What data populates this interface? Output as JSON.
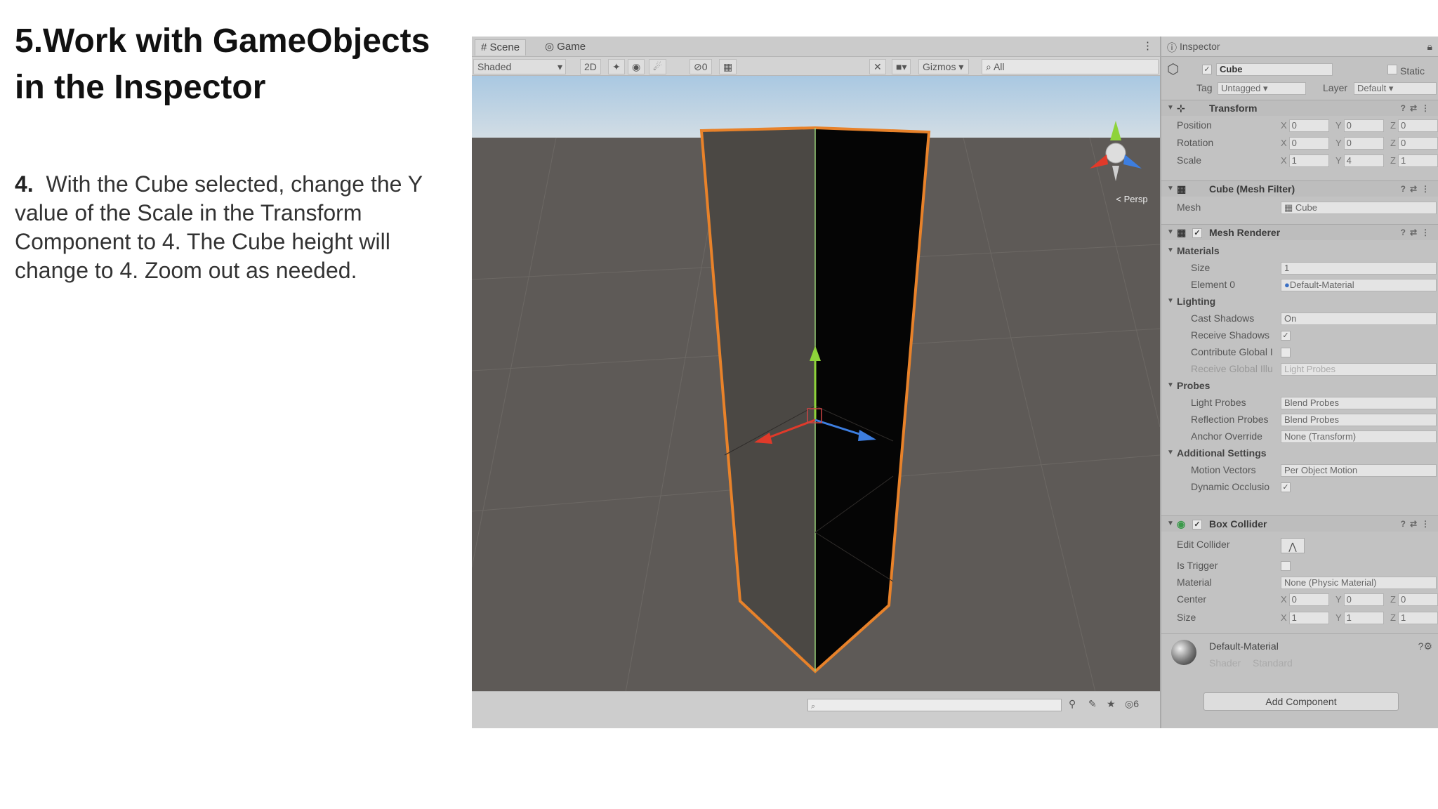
{
  "slide": {
    "title_line1": "5.Work with GameObjects",
    "title_line2": "in the Inspector",
    "step_number": "4.",
    "step_text": "With the Cube selected, change the Y value of the Scale in the Transform Component to 4. The Cube height will change to 4. Zoom out as needed."
  },
  "scene": {
    "tab_scene": "Scene",
    "tab_game": "Game",
    "shading_mode": "Shaded",
    "mode_2d": "2D",
    "gizmos_label": "Gizmos",
    "search_placeholder": "All",
    "persp_label": "< Persp",
    "layers_count": "0",
    "bottom_count": "6"
  },
  "inspector": {
    "tab_label": "Inspector",
    "object_name": "Cube",
    "static_label": "Static",
    "tag_label": "Tag",
    "tag_value": "Untagged",
    "layer_label": "Layer",
    "layer_value": "Default",
    "transform": {
      "title": "Transform",
      "position_label": "Position",
      "position": {
        "x": "0",
        "y": "0",
        "z": "0"
      },
      "rotation_label": "Rotation",
      "rotation": {
        "x": "0",
        "y": "0",
        "z": "0"
      },
      "scale_label": "Scale",
      "scale": {
        "x": "1",
        "y": "4",
        "z": "1"
      }
    },
    "mesh_filter": {
      "title": "Cube (Mesh Filter)",
      "mesh_label": "Mesh",
      "mesh_value": "Cube"
    },
    "mesh_renderer": {
      "title": "Mesh Renderer",
      "materials_label": "Materials",
      "size_label": "Size",
      "size_value": "1",
      "element0_label": "Element 0",
      "element0_value": "Default-Material",
      "lighting_label": "Lighting",
      "cast_shadows_label": "Cast Shadows",
      "cast_shadows_value": "On",
      "receive_shadows_label": "Receive Shadows",
      "contribute_gi_label": "Contribute Global I",
      "receive_gi_label": "Receive Global Illu",
      "receive_gi_value": "Light Probes",
      "probes_label": "Probes",
      "light_probes_label": "Light Probes",
      "light_probes_value": "Blend Probes",
      "reflection_probes_label": "Reflection Probes",
      "reflection_probes_value": "Blend Probes",
      "anchor_override_label": "Anchor Override",
      "anchor_override_value": "None (Transform)",
      "additional_label": "Additional Settings",
      "motion_vectors_label": "Motion Vectors",
      "motion_vectors_value": "Per Object Motion",
      "dynamic_occlusion_label": "Dynamic Occlusio"
    },
    "box_collider": {
      "title": "Box Collider",
      "edit_collider_label": "Edit Collider",
      "is_trigger_label": "Is Trigger",
      "material_label": "Material",
      "material_value": "None (Physic Material)",
      "center_label": "Center",
      "center": {
        "x": "0",
        "y": "0",
        "z": "0"
      },
      "size_label": "Size",
      "size": {
        "x": "1",
        "y": "1",
        "z": "1"
      }
    },
    "material": {
      "name": "Default-Material",
      "shader_label": "Shader",
      "shader_value": "Standard"
    },
    "add_component_label": "Add Component"
  },
  "colors": {
    "selection_outline": "#e8822a",
    "axis_x": "#e03a2a",
    "axis_y": "#8ed33a",
    "axis_z": "#3d7ee0",
    "ground": "#5e5a57",
    "sky": "#b9d3e6"
  }
}
